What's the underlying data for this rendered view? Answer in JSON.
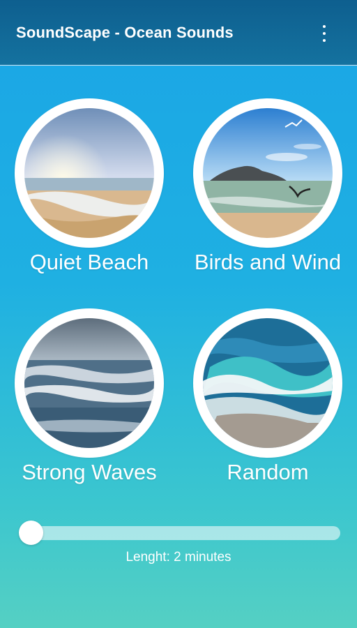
{
  "app": {
    "title": "SoundScape - Ocean Sounds",
    "menu_icon": "more-vert-icon"
  },
  "tiles": [
    {
      "label": "Quiet Beach",
      "image": "quiet-beach-image"
    },
    {
      "label": "Birds and Wind",
      "image": "birds-and-wind-image"
    },
    {
      "label": "Strong Waves",
      "image": "strong-waves-image"
    },
    {
      "label": "Random",
      "image": "random-image"
    }
  ],
  "length": {
    "label": "Lenght: 2 minutes",
    "slider_fraction": 0.0
  },
  "colors": {
    "appbar": "#0e5f8f",
    "background_top": "#1aa5e6",
    "background_bottom": "#55d0c3",
    "circle": "#ffffff"
  }
}
